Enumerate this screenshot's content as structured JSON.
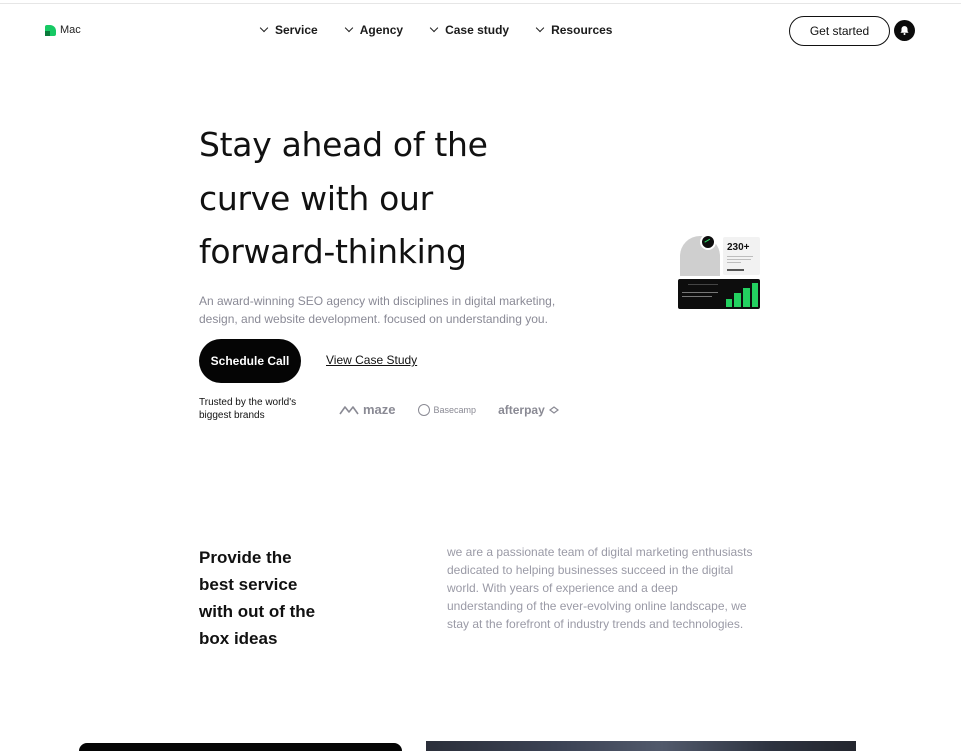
{
  "header": {
    "logo_text": "Mac",
    "nav": [
      {
        "label": "Service"
      },
      {
        "label": "Agency"
      },
      {
        "label": "Case study"
      },
      {
        "label": "Resources"
      }
    ],
    "cta_label": "Get started",
    "icons": {
      "bell": "bell-icon",
      "chevron": "chevron-down-icon"
    }
  },
  "hero": {
    "title_lines": [
      "Stay ahead of the",
      "curve with our",
      "forward-thinking"
    ],
    "description_lines": [
      "An award-winning SEO agency with disciplines in digital marketing,",
      "design, and website development. focused on understanding you."
    ],
    "primary_button": "Schedule Call",
    "secondary_link": "View Case Study",
    "trusted_lines": [
      "Trusted by the world's",
      "biggest brands"
    ],
    "brands": [
      "maze",
      "Basecamp",
      "afterpay"
    ],
    "widget": {
      "stat": "230+"
    }
  },
  "section2": {
    "title_lines": [
      "Provide the",
      "best service",
      "with out of the",
      "box ideas"
    ],
    "description_lines": [
      "we are a passionate team of digital marketing enthusiasts",
      "dedicated to helping businesses succeed in the digital",
      "world. With years of experience and a deep",
      "understanding of the ever-evolving online landscape, we",
      "stay at the forefront of industry trends and technologies."
    ]
  },
  "colors": {
    "accent": "#17c964",
    "text": "#111111",
    "muted": "#8a8a96",
    "button_bg": "#050505"
  }
}
